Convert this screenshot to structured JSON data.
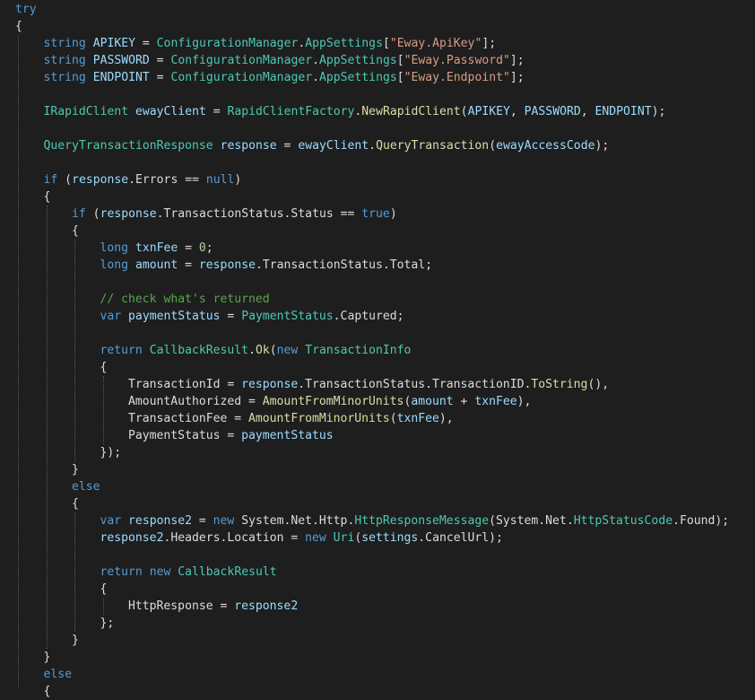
{
  "editor": {
    "language": "csharp",
    "colors": {
      "background": "#1e1e1e",
      "kw": "#569cd6",
      "ty": "#4ec9b0",
      "me": "#dcdcaa",
      "st": "#d69d85",
      "cm": "#57a64a",
      "va": "#9cdcfe",
      "nu": "#b5cea8",
      "pl": "#dcdcdc"
    },
    "lines": [
      {
        "indent": 0,
        "tokens": [
          [
            "kw",
            "try"
          ]
        ]
      },
      {
        "indent": 0,
        "tokens": [
          [
            "pl",
            "{"
          ]
        ]
      },
      {
        "indent": 1,
        "tokens": [
          [
            "kw",
            "string"
          ],
          [
            "pl",
            " "
          ],
          [
            "va",
            "APIKEY"
          ],
          [
            "pl",
            " = "
          ],
          [
            "ty",
            "ConfigurationManager"
          ],
          [
            "pl",
            "."
          ],
          [
            "ty",
            "AppSettings"
          ],
          [
            "pl",
            "["
          ],
          [
            "st",
            "\"Eway.ApiKey\""
          ],
          [
            "pl",
            "];"
          ]
        ]
      },
      {
        "indent": 1,
        "tokens": [
          [
            "kw",
            "string"
          ],
          [
            "pl",
            " "
          ],
          [
            "va",
            "PASSWORD"
          ],
          [
            "pl",
            " = "
          ],
          [
            "ty",
            "ConfigurationManager"
          ],
          [
            "pl",
            "."
          ],
          [
            "ty",
            "AppSettings"
          ],
          [
            "pl",
            "["
          ],
          [
            "st",
            "\"Eway.Password\""
          ],
          [
            "pl",
            "];"
          ]
        ]
      },
      {
        "indent": 1,
        "tokens": [
          [
            "kw",
            "string"
          ],
          [
            "pl",
            " "
          ],
          [
            "va",
            "ENDPOINT"
          ],
          [
            "pl",
            " = "
          ],
          [
            "ty",
            "ConfigurationManager"
          ],
          [
            "pl",
            "."
          ],
          [
            "ty",
            "AppSettings"
          ],
          [
            "pl",
            "["
          ],
          [
            "st",
            "\"Eway.Endpoint\""
          ],
          [
            "pl",
            "];"
          ]
        ]
      },
      {
        "indent": 0,
        "tokens": []
      },
      {
        "indent": 1,
        "tokens": [
          [
            "ty",
            "IRapidClient"
          ],
          [
            "pl",
            " "
          ],
          [
            "va",
            "ewayClient"
          ],
          [
            "pl",
            " = "
          ],
          [
            "ty",
            "RapidClientFactory"
          ],
          [
            "pl",
            "."
          ],
          [
            "me",
            "NewRapidClient"
          ],
          [
            "pl",
            "("
          ],
          [
            "va",
            "APIKEY"
          ],
          [
            "pl",
            ", "
          ],
          [
            "va",
            "PASSWORD"
          ],
          [
            "pl",
            ", "
          ],
          [
            "va",
            "ENDPOINT"
          ],
          [
            "pl",
            ");"
          ]
        ]
      },
      {
        "indent": 0,
        "tokens": []
      },
      {
        "indent": 1,
        "tokens": [
          [
            "ty",
            "QueryTransactionResponse"
          ],
          [
            "pl",
            " "
          ],
          [
            "va",
            "response"
          ],
          [
            "pl",
            " = "
          ],
          [
            "va",
            "ewayClient"
          ],
          [
            "pl",
            "."
          ],
          [
            "me",
            "QueryTransaction"
          ],
          [
            "pl",
            "("
          ],
          [
            "va",
            "ewayAccessCode"
          ],
          [
            "pl",
            ");"
          ]
        ]
      },
      {
        "indent": 0,
        "tokens": []
      },
      {
        "indent": 1,
        "tokens": [
          [
            "kw",
            "if"
          ],
          [
            "pl",
            " ("
          ],
          [
            "va",
            "response"
          ],
          [
            "pl",
            ".Errors == "
          ],
          [
            "kw",
            "null"
          ],
          [
            "pl",
            ")"
          ]
        ]
      },
      {
        "indent": 1,
        "tokens": [
          [
            "pl",
            "{"
          ]
        ]
      },
      {
        "indent": 2,
        "tokens": [
          [
            "kw",
            "if"
          ],
          [
            "pl",
            " ("
          ],
          [
            "va",
            "response"
          ],
          [
            "pl",
            ".TransactionStatus.Status == "
          ],
          [
            "kw",
            "true"
          ],
          [
            "pl",
            ")"
          ]
        ]
      },
      {
        "indent": 2,
        "tokens": [
          [
            "pl",
            "{"
          ]
        ]
      },
      {
        "indent": 3,
        "tokens": [
          [
            "kw",
            "long"
          ],
          [
            "pl",
            " "
          ],
          [
            "va",
            "txnFee"
          ],
          [
            "pl",
            " = "
          ],
          [
            "nu",
            "0"
          ],
          [
            "pl",
            ";"
          ]
        ]
      },
      {
        "indent": 3,
        "tokens": [
          [
            "kw",
            "long"
          ],
          [
            "pl",
            " "
          ],
          [
            "va",
            "amount"
          ],
          [
            "pl",
            " = "
          ],
          [
            "va",
            "response"
          ],
          [
            "pl",
            ".TransactionStatus.Total;"
          ]
        ]
      },
      {
        "indent": 0,
        "tokens": []
      },
      {
        "indent": 3,
        "tokens": [
          [
            "cm",
            "// check what's returned"
          ]
        ]
      },
      {
        "indent": 3,
        "tokens": [
          [
            "kw",
            "var"
          ],
          [
            "pl",
            " "
          ],
          [
            "va",
            "paymentStatus"
          ],
          [
            "pl",
            " = "
          ],
          [
            "ty",
            "PaymentStatus"
          ],
          [
            "pl",
            ".Captured;"
          ]
        ]
      },
      {
        "indent": 0,
        "tokens": []
      },
      {
        "indent": 3,
        "tokens": [
          [
            "kw",
            "return"
          ],
          [
            "pl",
            " "
          ],
          [
            "ty",
            "CallbackResult"
          ],
          [
            "pl",
            "."
          ],
          [
            "me",
            "Ok"
          ],
          [
            "pl",
            "("
          ],
          [
            "kw",
            "new"
          ],
          [
            "pl",
            " "
          ],
          [
            "ty",
            "TransactionInfo"
          ]
        ]
      },
      {
        "indent": 3,
        "tokens": [
          [
            "pl",
            "{"
          ]
        ]
      },
      {
        "indent": 4,
        "tokens": [
          [
            "pl",
            "TransactionId = "
          ],
          [
            "va",
            "response"
          ],
          [
            "pl",
            ".TransactionStatus.TransactionID."
          ],
          [
            "me",
            "ToString"
          ],
          [
            "pl",
            "(),"
          ]
        ]
      },
      {
        "indent": 4,
        "tokens": [
          [
            "pl",
            "AmountAuthorized = "
          ],
          [
            "me",
            "AmountFromMinorUnits"
          ],
          [
            "pl",
            "("
          ],
          [
            "va",
            "amount"
          ],
          [
            "pl",
            " + "
          ],
          [
            "va",
            "txnFee"
          ],
          [
            "pl",
            "),"
          ]
        ]
      },
      {
        "indent": 4,
        "tokens": [
          [
            "pl",
            "TransactionFee = "
          ],
          [
            "me",
            "AmountFromMinorUnits"
          ],
          [
            "pl",
            "("
          ],
          [
            "va",
            "txnFee"
          ],
          [
            "pl",
            "),"
          ]
        ]
      },
      {
        "indent": 4,
        "tokens": [
          [
            "pl",
            "PaymentStatus = "
          ],
          [
            "va",
            "paymentStatus"
          ]
        ]
      },
      {
        "indent": 3,
        "tokens": [
          [
            "pl",
            "});"
          ]
        ]
      },
      {
        "indent": 2,
        "tokens": [
          [
            "pl",
            "}"
          ]
        ]
      },
      {
        "indent": 2,
        "tokens": [
          [
            "kw",
            "else"
          ]
        ]
      },
      {
        "indent": 2,
        "tokens": [
          [
            "pl",
            "{"
          ]
        ]
      },
      {
        "indent": 3,
        "tokens": [
          [
            "kw",
            "var"
          ],
          [
            "pl",
            " "
          ],
          [
            "va",
            "response2"
          ],
          [
            "pl",
            " = "
          ],
          [
            "kw",
            "new"
          ],
          [
            "pl",
            " System.Net.Http."
          ],
          [
            "ty",
            "HttpResponseMessage"
          ],
          [
            "pl",
            "(System.Net."
          ],
          [
            "ty",
            "HttpStatusCode"
          ],
          [
            "pl",
            ".Found);"
          ]
        ]
      },
      {
        "indent": 3,
        "tokens": [
          [
            "va",
            "response2"
          ],
          [
            "pl",
            ".Headers.Location = "
          ],
          [
            "kw",
            "new"
          ],
          [
            "pl",
            " "
          ],
          [
            "ty",
            "Uri"
          ],
          [
            "pl",
            "("
          ],
          [
            "va",
            "settings"
          ],
          [
            "pl",
            ".CancelUrl);"
          ]
        ]
      },
      {
        "indent": 0,
        "tokens": []
      },
      {
        "indent": 3,
        "tokens": [
          [
            "kw",
            "return"
          ],
          [
            "pl",
            " "
          ],
          [
            "kw",
            "new"
          ],
          [
            "pl",
            " "
          ],
          [
            "ty",
            "CallbackResult"
          ]
        ]
      },
      {
        "indent": 3,
        "tokens": [
          [
            "pl",
            "{"
          ]
        ]
      },
      {
        "indent": 4,
        "tokens": [
          [
            "pl",
            "HttpResponse = "
          ],
          [
            "va",
            "response2"
          ]
        ]
      },
      {
        "indent": 3,
        "tokens": [
          [
            "pl",
            "};"
          ]
        ]
      },
      {
        "indent": 2,
        "tokens": [
          [
            "pl",
            "}"
          ]
        ]
      },
      {
        "indent": 1,
        "tokens": [
          [
            "pl",
            "}"
          ]
        ]
      },
      {
        "indent": 1,
        "tokens": [
          [
            "kw",
            "else"
          ]
        ]
      },
      {
        "indent": 1,
        "tokens": [
          [
            "pl",
            "{"
          ]
        ]
      }
    ]
  }
}
